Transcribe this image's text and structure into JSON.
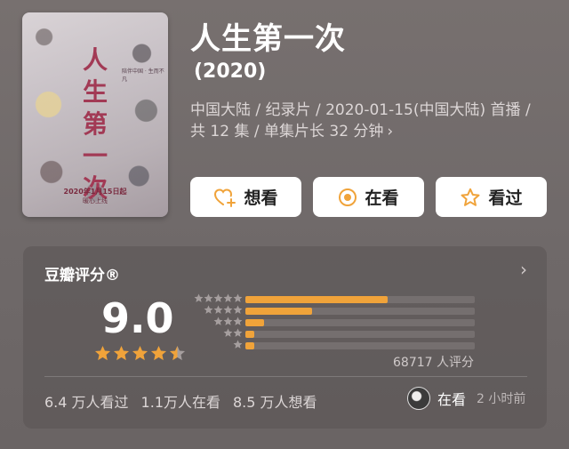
{
  "poster": {
    "title_chars": [
      "人",
      "生",
      "第",
      "一",
      "次"
    ],
    "date_text": "2020年1月15日起",
    "sub_text": "暖心上线",
    "tag_text": "陪伴中国 · 生而不凡"
  },
  "movie": {
    "title": "人生第一次",
    "year": "(2020)",
    "meta_line1": "中国大陆 / 纪录片 / 2020-01-15(中国大陆) 首播 /",
    "meta_line2": "共 12 集 / 单集片长 32 分钟"
  },
  "actions": {
    "want_label": "想看",
    "watching_label": "在看",
    "watched_label": "看过"
  },
  "rating": {
    "header": "豆瓣评分®",
    "score": "9.0",
    "stars": 4.5,
    "distribution": [
      {
        "stars": 5,
        "fraction": 0.62
      },
      {
        "stars": 4,
        "fraction": 0.29
      },
      {
        "stars": 3,
        "fraction": 0.08
      },
      {
        "stars": 2,
        "fraction": 0.04
      },
      {
        "stars": 1,
        "fraction": 0.04
      }
    ],
    "count_text": "68717 人评分"
  },
  "stats": {
    "watched": "6.4 万人看过",
    "watching": "1.1万人在看",
    "want": "8.5 万人想看"
  },
  "friend": {
    "status": "在看",
    "time": "2 小时前"
  },
  "colors": {
    "accent": "#f0a33a",
    "background": "#726c6c",
    "button_bg": "#ffffff"
  }
}
